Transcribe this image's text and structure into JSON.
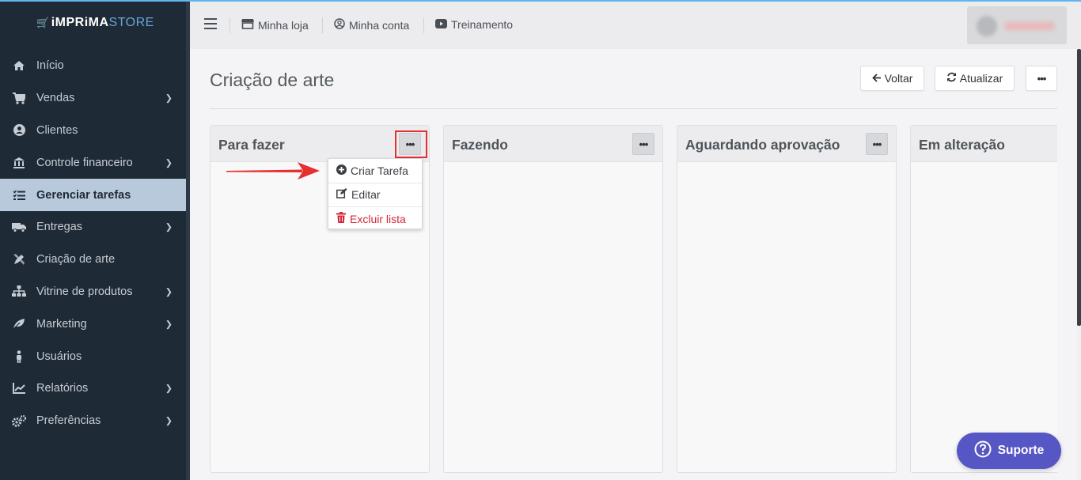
{
  "brand": {
    "name_part1": "iMPRiMA",
    "name_part2": "STORE"
  },
  "sidebar": {
    "items": [
      {
        "label": "Início",
        "icon": "home-icon",
        "has_submenu": false,
        "active": false
      },
      {
        "label": "Vendas",
        "icon": "cart-icon",
        "has_submenu": true,
        "active": false
      },
      {
        "label": "Clientes",
        "icon": "user-circle-icon",
        "has_submenu": false,
        "active": false
      },
      {
        "label": "Controle financeiro",
        "icon": "bank-icon",
        "has_submenu": true,
        "active": false
      },
      {
        "label": "Gerenciar tarefas",
        "icon": "tasks-icon",
        "has_submenu": false,
        "active": true
      },
      {
        "label": "Entregas",
        "icon": "truck-icon",
        "has_submenu": true,
        "active": false
      },
      {
        "label": "Criação de arte",
        "icon": "design-tools-icon",
        "has_submenu": false,
        "active": false
      },
      {
        "label": "Vitrine de produtos",
        "icon": "sitemap-icon",
        "has_submenu": true,
        "active": false
      },
      {
        "label": "Marketing",
        "icon": "leaf-icon",
        "has_submenu": true,
        "active": false
      },
      {
        "label": "Usuários",
        "icon": "person-icon",
        "has_submenu": false,
        "active": false
      },
      {
        "label": "Relatórios",
        "icon": "line-chart-icon",
        "has_submenu": true,
        "active": false
      },
      {
        "label": "Preferências",
        "icon": "gears-icon",
        "has_submenu": true,
        "active": false
      }
    ]
  },
  "topbar": {
    "links": [
      {
        "label": "Minha loja",
        "icon": "store-icon"
      },
      {
        "label": "Minha conta",
        "icon": "account-icon"
      },
      {
        "label": "Treinamento",
        "icon": "youtube-icon"
      }
    ]
  },
  "page": {
    "title": "Criação de arte",
    "buttons": {
      "back": "Voltar",
      "refresh": "Atualizar",
      "more": "•••"
    }
  },
  "board": {
    "columns": [
      {
        "title": "Para fazer"
      },
      {
        "title": "Fazendo"
      },
      {
        "title": "Aguardando aprovação"
      },
      {
        "title": "Em alteração"
      }
    ],
    "dropdown": {
      "items": [
        {
          "label": "Criar Tarefa",
          "icon": "plus-circle-icon"
        },
        {
          "label": "Editar",
          "icon": "edit-icon"
        },
        {
          "label": "Excluir lista",
          "icon": "trash-icon"
        }
      ]
    }
  },
  "support": {
    "label": "Suporte"
  },
  "colors": {
    "sidebar_bg": "#1e2a36",
    "sidebar_active": "#b8c9dc",
    "support_bg": "#5656c4",
    "danger": "#d4283a",
    "highlight": "#e53030"
  }
}
